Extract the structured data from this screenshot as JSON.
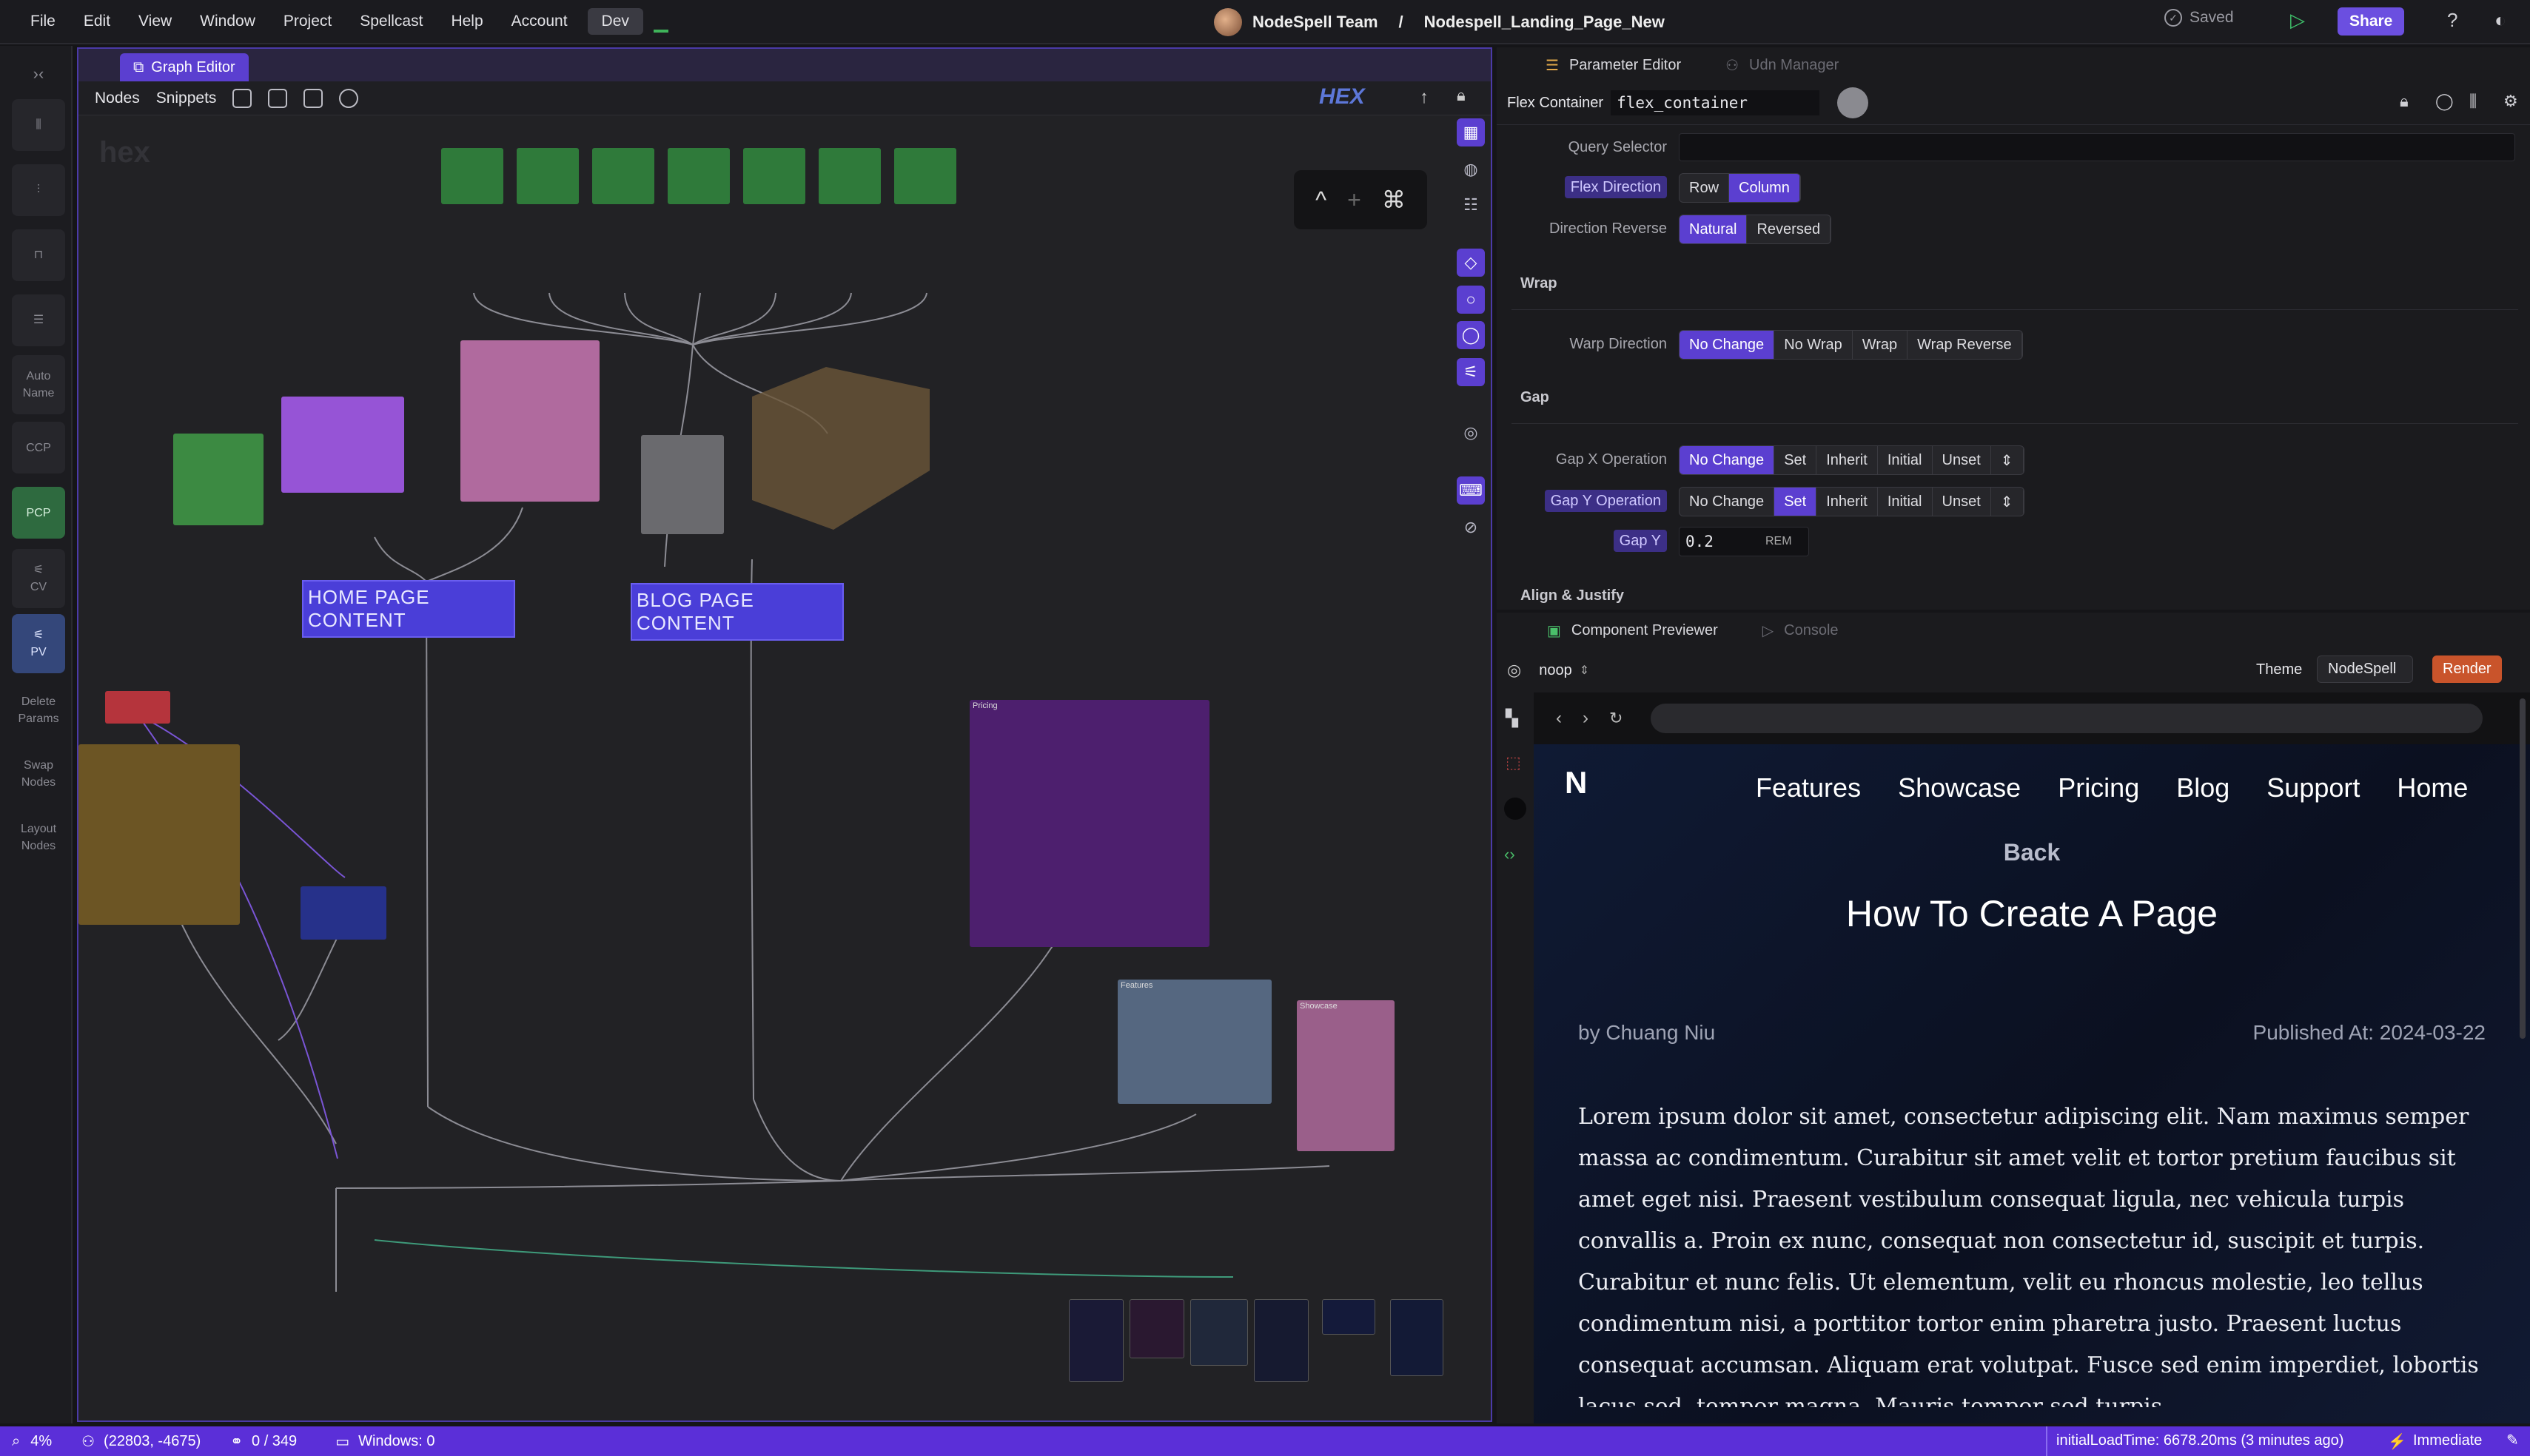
{
  "menubar": {
    "items": [
      "File",
      "Edit",
      "View",
      "Window",
      "Project",
      "Spellcast",
      "Help",
      "Account",
      "Dev"
    ],
    "team": "NodeSpell Team",
    "separator": "/",
    "project": "Nodespell_Landing_Page_New",
    "saved": "Saved",
    "share": "Share",
    "help": "?"
  },
  "rail": {
    "auto_name": "Auto Name",
    "ccp": "CCP",
    "pcp": "PCP",
    "cv": "CV",
    "pv": "PV",
    "delete_params": "Delete Params",
    "swap_nodes": "Swap Nodes",
    "layout_nodes": "Layout Nodes"
  },
  "graph": {
    "tab": "Graph Editor",
    "nodes": "Nodes",
    "snippets": "Snippets",
    "hex_logo": "HEX",
    "watermark": "hex",
    "home_group": "HOME PAGE CONTENT",
    "blog_group": "BLOG PAGE CONTENT",
    "pricing": "Pricing",
    "features": "Features",
    "showcase": "Showcase",
    "kbd": [
      "^",
      "+",
      "⌘"
    ]
  },
  "params": {
    "tab_active": "Parameter Editor",
    "tab_other": "Udn Manager",
    "component_type": "Flex Container",
    "component_name": "flex_container",
    "query_selector": "Query Selector",
    "flex_direction": {
      "label": "Flex Direction",
      "options": [
        "Row",
        "Column"
      ],
      "selected": "Column"
    },
    "direction_reverse": {
      "label": "Direction Reverse",
      "options": [
        "Natural",
        "Reversed"
      ],
      "selected": "Natural"
    },
    "wrap_section": "Wrap",
    "warp_direction": {
      "label": "Warp Direction",
      "options": [
        "No Change",
        "No Wrap",
        "Wrap",
        "Wrap Reverse"
      ],
      "selected": "No Change"
    },
    "gap_section": "Gap",
    "gap_x": {
      "label": "Gap X Operation",
      "options": [
        "No Change",
        "Set",
        "Inherit",
        "Initial",
        "Unset"
      ],
      "selected": "No Change"
    },
    "gap_y": {
      "label": "Gap Y Operation",
      "options": [
        "No Change",
        "Set",
        "Inherit",
        "Initial",
        "Unset"
      ],
      "selected": "Set"
    },
    "gap_y_value": {
      "label": "Gap Y",
      "value": "0.2",
      "unit": "REM"
    },
    "align_section": "Align & Justify"
  },
  "preview": {
    "tab_active": "Component Previewer",
    "tab_other": "Console",
    "mode": "noop",
    "theme_label": "Theme",
    "theme": "NodeSpell",
    "render": "Render",
    "nav": [
      "Features",
      "Showcase",
      "Pricing",
      "Blog",
      "Support",
      "Home"
    ],
    "back": "Back",
    "title": "How To Create A Page",
    "author": "by Chuang Niu",
    "published": "Published At: 2024-03-22",
    "body": "Lorem ipsum dolor sit amet, consectetur adipiscing elit. Nam maximus semper massa ac condimentum. Curabitur sit amet velit et tortor pretium faucibus sit amet eget nisi. Praesent vestibulum consequat ligula, nec vehicula turpis convallis a. Proin ex nunc, consequat non consectetur id, suscipit et turpis. Curabitur et nunc felis. Ut elementum, velit eu rhoncus molestie, leo tellus condimentum nisi, a porttitor tortor enim pharetra justo. Praesent luctus consequat accumsan. Aliquam erat volutpat. Fusce sed enim imperdiet, lobortis lacus sed, tempor magna. Mauris tempor sed turpis"
  },
  "status": {
    "zoom": "4%",
    "coords": "(22803, -4675)",
    "count": "0 / 349",
    "windows": "Windows: 0",
    "load_time": "initialLoadTime: 6678.20ms (3 minutes ago)",
    "mode": "Immediate"
  },
  "colors": {
    "accent": "#5b3fd0",
    "statusbar": "#5b2fd8",
    "render": "#c9542b"
  }
}
